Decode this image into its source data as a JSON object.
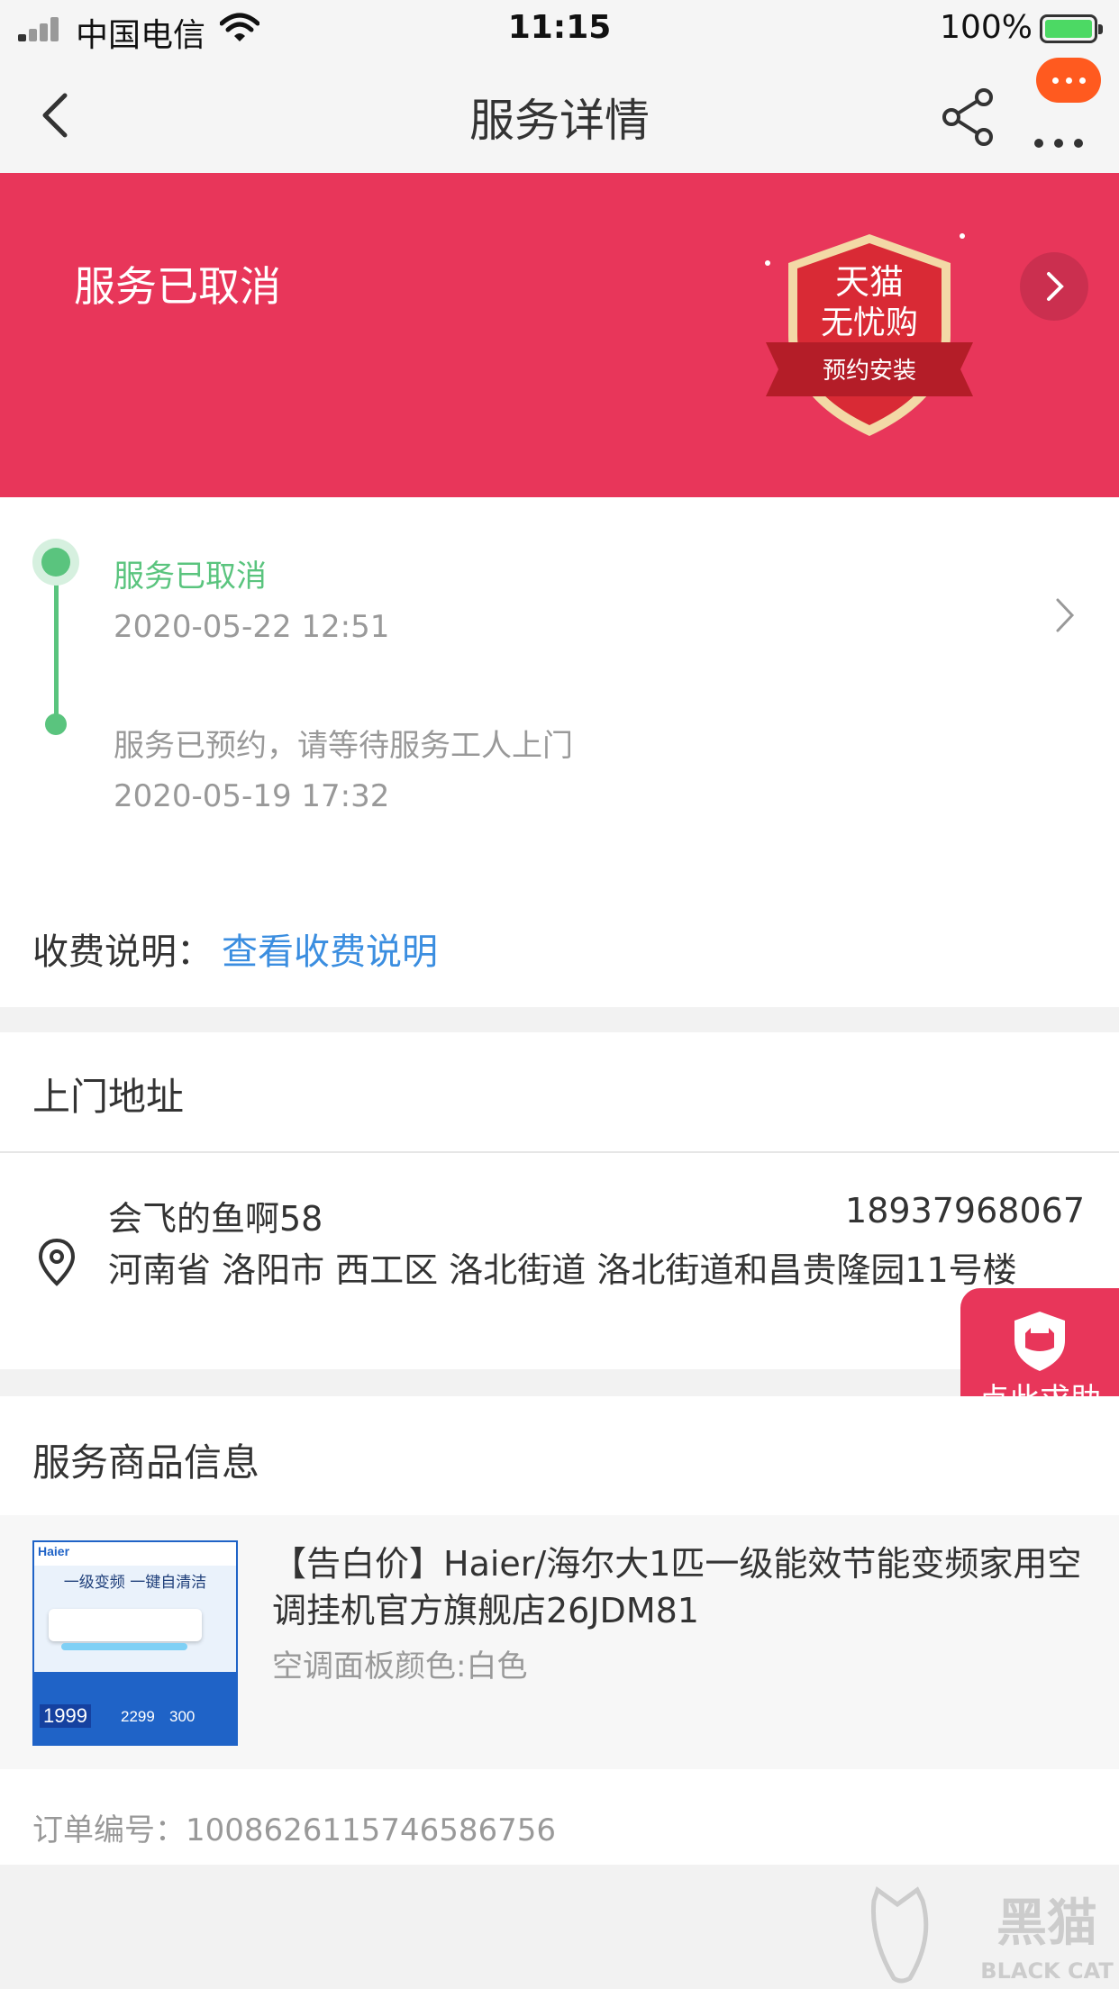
{
  "status_bar": {
    "carrier": "中国电信",
    "time": "11:15",
    "battery_pct": "100%"
  },
  "nav": {
    "title": "服务详情",
    "icons": [
      "back-arrow-icon",
      "share-icon",
      "more-dots-icon",
      "message-bubble-icon"
    ]
  },
  "banner": {
    "status": "服务已取消",
    "badge_line1": "天猫",
    "badge_line2": "无忧购",
    "badge_ribbon": "预约安装",
    "color": "#e8365a"
  },
  "timeline": {
    "events": [
      {
        "status": "服务已取消",
        "time": "2020-05-22 12:51"
      },
      {
        "status": "服务已预约，请等待服务工人上门",
        "time": "2020-05-19 17:32"
      }
    ],
    "accent": "#5ac47e"
  },
  "fee": {
    "label": "收费说明：",
    "link": "查看收费说明"
  },
  "address": {
    "header": "上门地址",
    "name": "会飞的鱼啊58",
    "phone": "18937968067",
    "detail": "河南省 洛阳市 西工区 洛北街道 洛北街道和昌贵隆园11号楼"
  },
  "help": {
    "label": "点此求助"
  },
  "product": {
    "header": "服务商品信息",
    "title": "【告白价】Haier/海尔大1匹一级能效节能变频家用空调挂机官方旗舰店26JDM81",
    "spec": "空调面板颜色:白色",
    "img": {
      "brand": "Haier",
      "headline": "一级变频 一键自清洁",
      "price_now": "1999",
      "price_orig": "2299",
      "price_off": "300"
    }
  },
  "order": {
    "label": "订单编号：",
    "number": "1008626115746586756"
  },
  "watermark": {
    "cn": "黑猫",
    "en": "BLACK CAT"
  }
}
